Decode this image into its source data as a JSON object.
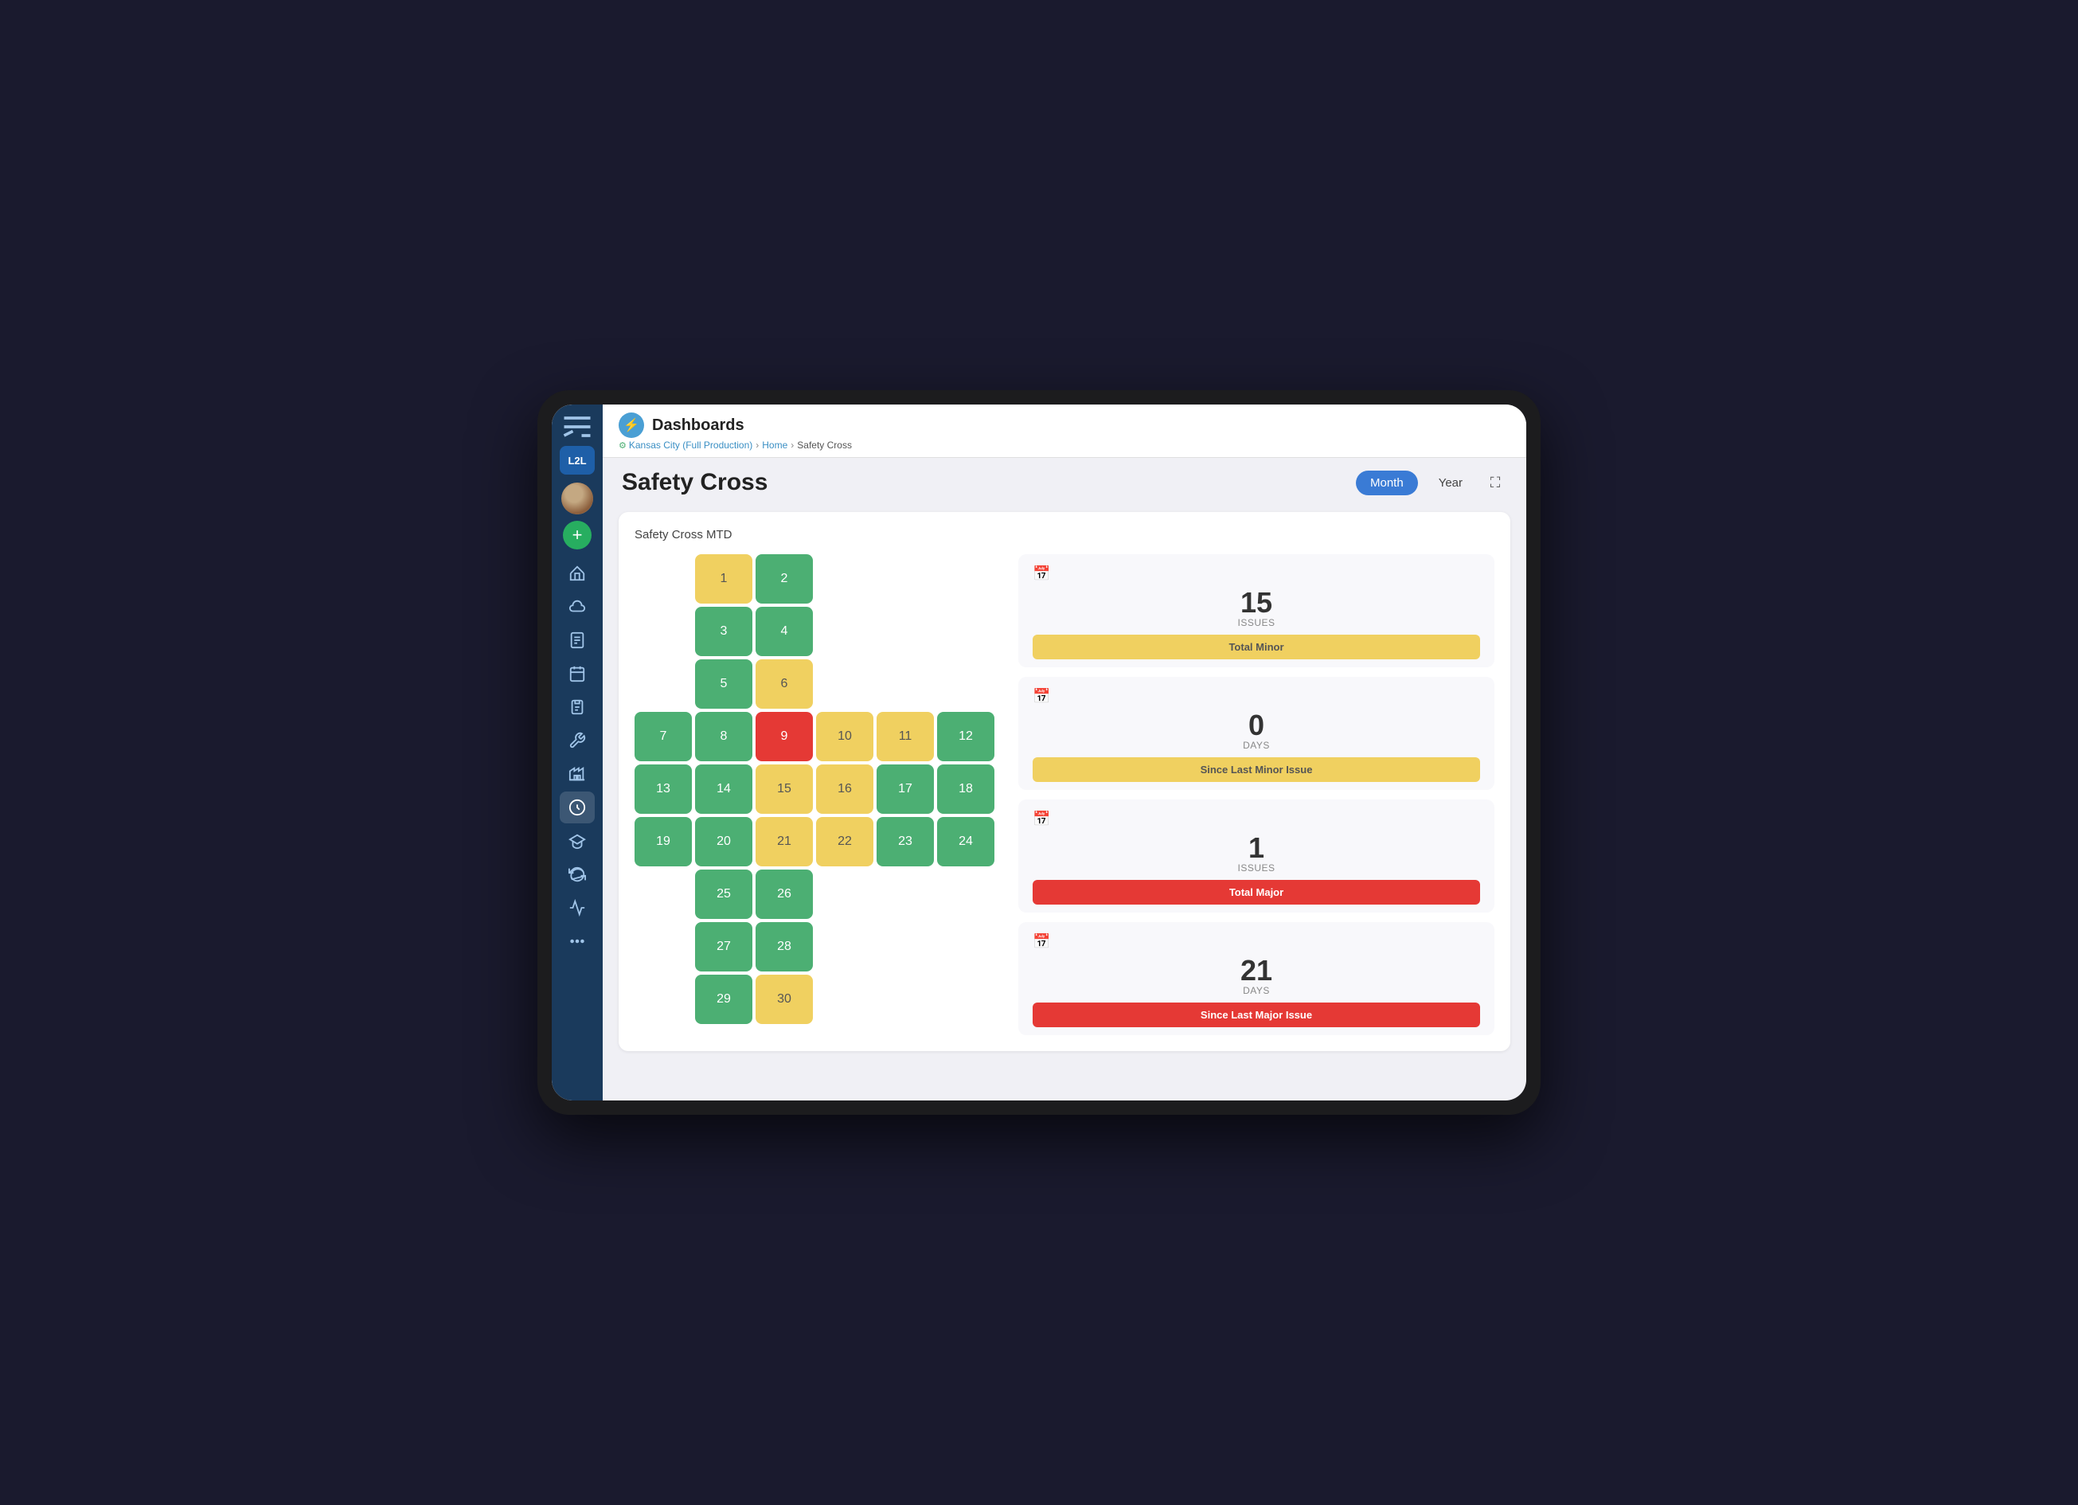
{
  "app": {
    "name": "Dashboards",
    "breadcrumb": {
      "site": "Kansas City (Full Production)",
      "parent": "Home",
      "current": "Safety Cross"
    }
  },
  "page": {
    "title": "Safety Cross",
    "view_toggle": {
      "month_label": "Month",
      "year_label": "Year",
      "active": "Month"
    },
    "card_title": "Safety Cross MTD"
  },
  "sidebar": {
    "logo": "L2L",
    "add_label": "+",
    "nav_items": [
      {
        "name": "home",
        "icon": "home"
      },
      {
        "name": "cloud",
        "icon": "cloud"
      },
      {
        "name": "document",
        "icon": "document"
      },
      {
        "name": "calendar",
        "icon": "calendar"
      },
      {
        "name": "clipboard",
        "icon": "clipboard"
      },
      {
        "name": "wrench",
        "icon": "wrench"
      },
      {
        "name": "factory",
        "icon": "factory"
      },
      {
        "name": "dashboard",
        "icon": "dashboard"
      },
      {
        "name": "graduation",
        "icon": "graduation"
      },
      {
        "name": "cycle",
        "icon": "cycle"
      },
      {
        "name": "chart",
        "icon": "chart"
      },
      {
        "name": "more",
        "icon": "more"
      }
    ]
  },
  "safety_cross": {
    "cells": [
      {
        "row": 0,
        "col": 0,
        "day": 1,
        "color": "yellow",
        "offset": 2
      },
      {
        "row": 0,
        "col": 1,
        "day": 2,
        "color": "green"
      },
      {
        "row": 1,
        "col": 0,
        "day": 3,
        "color": "green"
      },
      {
        "row": 1,
        "col": 1,
        "day": 4,
        "color": "green"
      },
      {
        "row": 2,
        "col": 0,
        "day": 5,
        "color": "green"
      },
      {
        "row": 2,
        "col": 1,
        "day": 6,
        "color": "yellow"
      },
      {
        "row": 3,
        "col": 0,
        "day": 7,
        "color": "green"
      },
      {
        "row": 3,
        "col": 1,
        "day": 8,
        "color": "green"
      },
      {
        "row": 3,
        "col": 2,
        "day": 9,
        "color": "red"
      },
      {
        "row": 3,
        "col": 3,
        "day": 10,
        "color": "yellow"
      },
      {
        "row": 3,
        "col": 4,
        "day": 11,
        "color": "yellow"
      },
      {
        "row": 3,
        "col": 5,
        "day": 12,
        "color": "green"
      },
      {
        "row": 4,
        "col": 0,
        "day": 13,
        "color": "green"
      },
      {
        "row": 4,
        "col": 1,
        "day": 14,
        "color": "green"
      },
      {
        "row": 4,
        "col": 2,
        "day": 15,
        "color": "yellow"
      },
      {
        "row": 4,
        "col": 3,
        "day": 16,
        "color": "yellow"
      },
      {
        "row": 4,
        "col": 4,
        "day": 17,
        "color": "green"
      },
      {
        "row": 4,
        "col": 5,
        "day": 18,
        "color": "green"
      },
      {
        "row": 5,
        "col": 0,
        "day": 19,
        "color": "green"
      },
      {
        "row": 5,
        "col": 1,
        "day": 20,
        "color": "green"
      },
      {
        "row": 5,
        "col": 2,
        "day": 21,
        "color": "yellow"
      },
      {
        "row": 5,
        "col": 3,
        "day": 22,
        "color": "yellow"
      },
      {
        "row": 5,
        "col": 4,
        "day": 23,
        "color": "green"
      },
      {
        "row": 5,
        "col": 5,
        "day": 24,
        "color": "green"
      },
      {
        "row": 6,
        "col": 0,
        "day": 25,
        "color": "green"
      },
      {
        "row": 6,
        "col": 1,
        "day": 26,
        "color": "green"
      },
      {
        "row": 7,
        "col": 0,
        "day": 27,
        "color": "green"
      },
      {
        "row": 7,
        "col": 1,
        "day": 28,
        "color": "green"
      },
      {
        "row": 8,
        "col": 0,
        "day": 29,
        "color": "green"
      },
      {
        "row": 8,
        "col": 1,
        "day": 30,
        "color": "yellow"
      }
    ]
  },
  "stats": [
    {
      "number": "15",
      "unit": "ISSUES",
      "bar_label": "Total Minor",
      "bar_color": "yellow"
    },
    {
      "number": "0",
      "unit": "DAYS",
      "bar_label": "Since Last Minor Issue",
      "bar_color": "yellow"
    },
    {
      "number": "1",
      "unit": "ISSUES",
      "bar_label": "Total Major",
      "bar_color": "red"
    },
    {
      "number": "21",
      "unit": "DAYS",
      "bar_label": "Since Last Major Issue",
      "bar_color": "red"
    }
  ]
}
